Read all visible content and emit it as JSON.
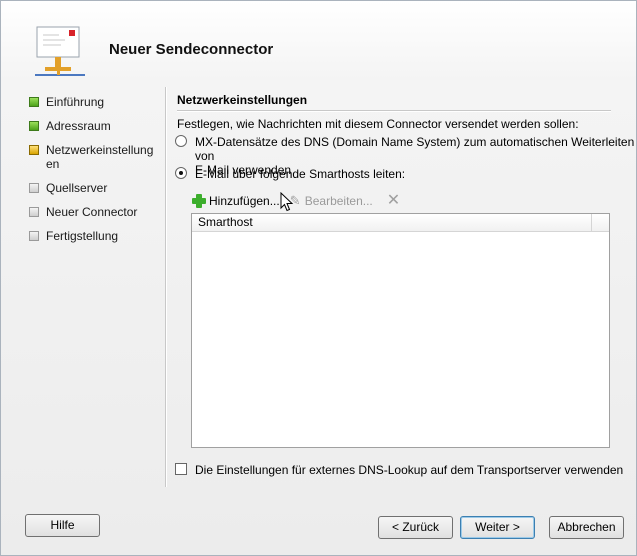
{
  "window": {
    "title": "Neuer Sendeconnector"
  },
  "nav": {
    "items": [
      {
        "label": "Einführung",
        "status": "green"
      },
      {
        "label": "Adressraum",
        "status": "green"
      },
      {
        "label": "Netzwerkeinstellungen",
        "status": "yellow"
      },
      {
        "label": "Quellserver",
        "status": "gray"
      },
      {
        "label": "Neuer Connector",
        "status": "gray"
      },
      {
        "label": "Fertigstellung",
        "status": "gray"
      }
    ]
  },
  "content": {
    "section_title": "Netzwerkeinstellungen",
    "intro": "Festlegen, wie Nachrichten mit diesem Connector versendet werden sollen:",
    "option_mx_line1": "MX-Datensätze des DNS (Domain Name System) zum automatischen Weiterleiten von",
    "option_mx_line2": "E-Mail verwenden",
    "option_smarthost": "E-Mail über folgende Smarthosts leiten:",
    "selected_option": "smarthost",
    "toolbar": {
      "add_label": "Hinzufügen...",
      "edit_label": "Bearbeiten...",
      "delete_icon": "delete-icon"
    },
    "list": {
      "column_header": "Smarthost",
      "rows": []
    },
    "dns_checkbox_label": "Die Einstellungen für externes DNS-Lookup auf dem Transportserver verwenden",
    "dns_checkbox_checked": false
  },
  "buttons": {
    "help": "Hilfe",
    "back": "< Zurück",
    "next": "Weiter >",
    "cancel": "Abbrechen"
  },
  "colors": {
    "step_done": "#4da21a",
    "step_current": "#d9a400",
    "step_pending": "#cfcfcf",
    "add_icon": "#3cae2c"
  }
}
